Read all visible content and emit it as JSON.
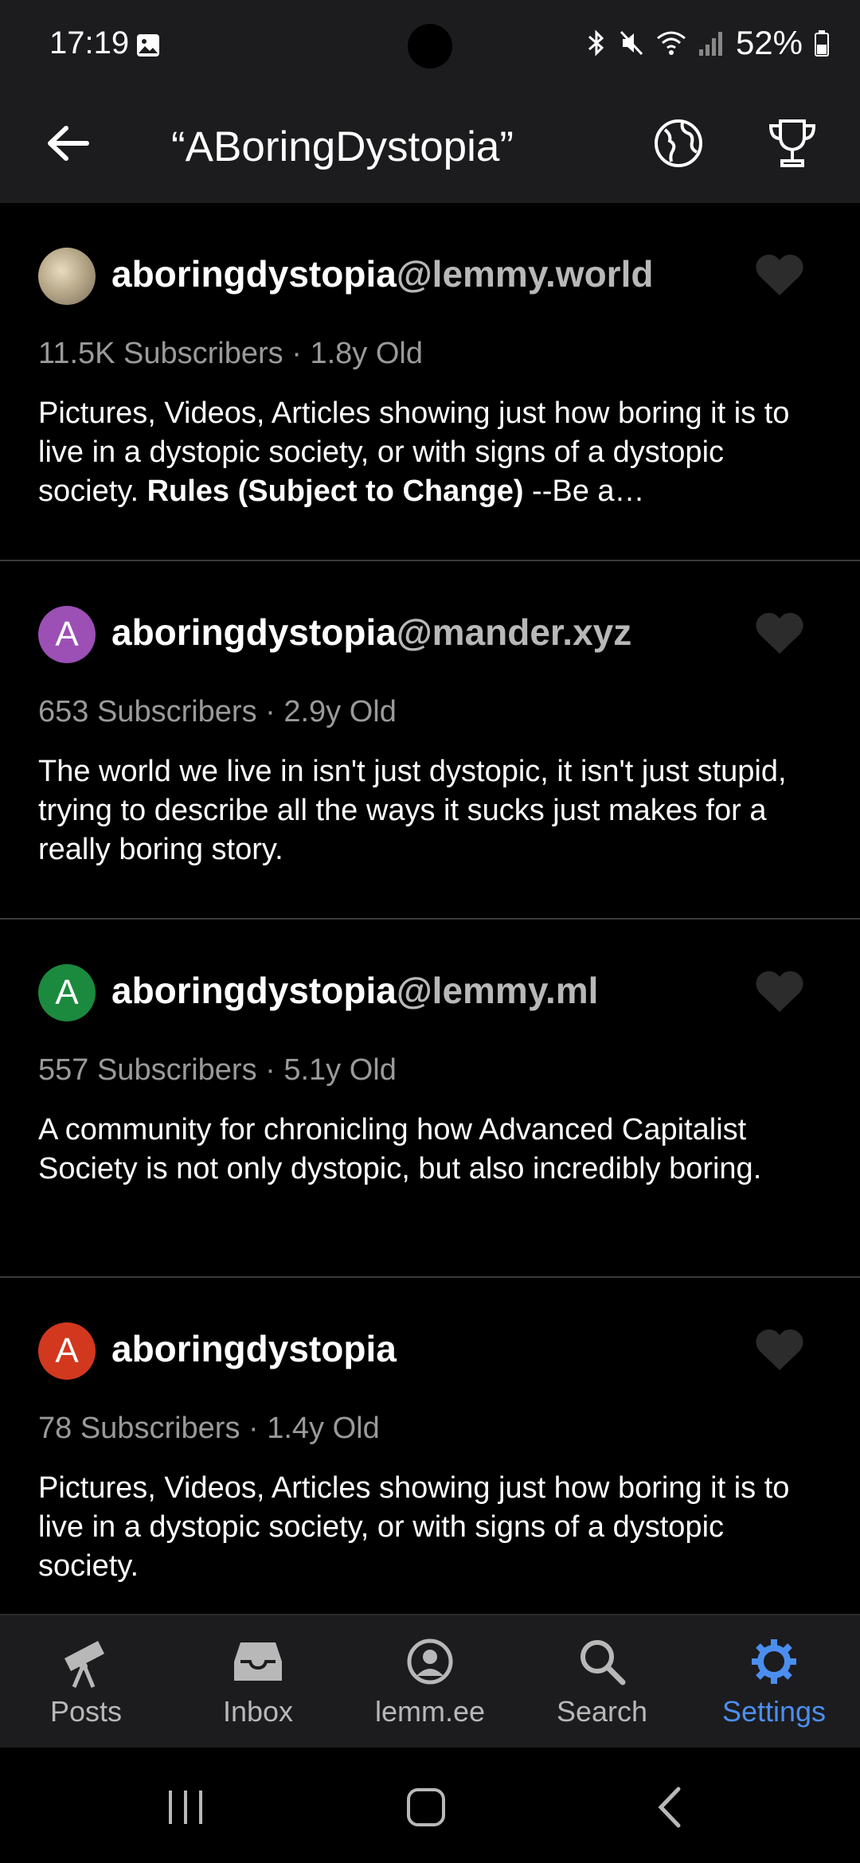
{
  "status_bar": {
    "time": "17:19",
    "battery": "52%"
  },
  "header": {
    "title": "“ABoringDystopia”"
  },
  "communities": [
    {
      "avatar_letter": "",
      "name": "aboringdystopia",
      "host": "@lemmy.world",
      "meta": "11.5K Subscribers · 1.8y Old",
      "desc_plain": "Pictures, Videos, Articles showing just how boring it is to live in a dystopic society, or with signs of a dystopic society. ",
      "desc_bold": "Rules (Subject to Change)",
      "desc_tail": " --Be a…"
    },
    {
      "avatar_letter": "A",
      "avatar_color": "#9c4fb5",
      "name": "aboringdystopia",
      "host": "@mander.xyz",
      "meta": "653 Subscribers · 2.9y Old",
      "desc_plain": "The world we live in isn't just dystopic, it isn't just stupid, trying to describe all the ways it sucks just makes for a really boring story."
    },
    {
      "avatar_letter": "A",
      "avatar_color": "#1c8a3e",
      "name": "aboringdystopia",
      "host": "@lemmy.ml",
      "meta": "557 Subscribers · 5.1y Old",
      "desc_plain": "A community for chronicling how Advanced Capitalist Society is not only dystopic, but also incredibly boring."
    },
    {
      "avatar_letter": "A",
      "avatar_color": "#d2381e",
      "name": "aboringdystopia",
      "host": "",
      "meta": "78 Subscribers · 1.4y Old",
      "desc_plain": "Pictures, Videos, Articles showing just how boring it is to live in a dystopic society, or with signs of a dystopic society."
    }
  ],
  "bottom_nav": [
    {
      "label": "Posts",
      "icon": "telescope-icon"
    },
    {
      "label": "Inbox",
      "icon": "inbox-icon"
    },
    {
      "label": "lemm.ee",
      "icon": "account-icon"
    },
    {
      "label": "Search",
      "icon": "search-icon"
    },
    {
      "label": "Settings",
      "icon": "gear-icon",
      "active": true
    }
  ],
  "colors": {
    "accent": "#4c8ef0",
    "bar_bg": "#1c1c1e",
    "body_bg": "#000000"
  }
}
